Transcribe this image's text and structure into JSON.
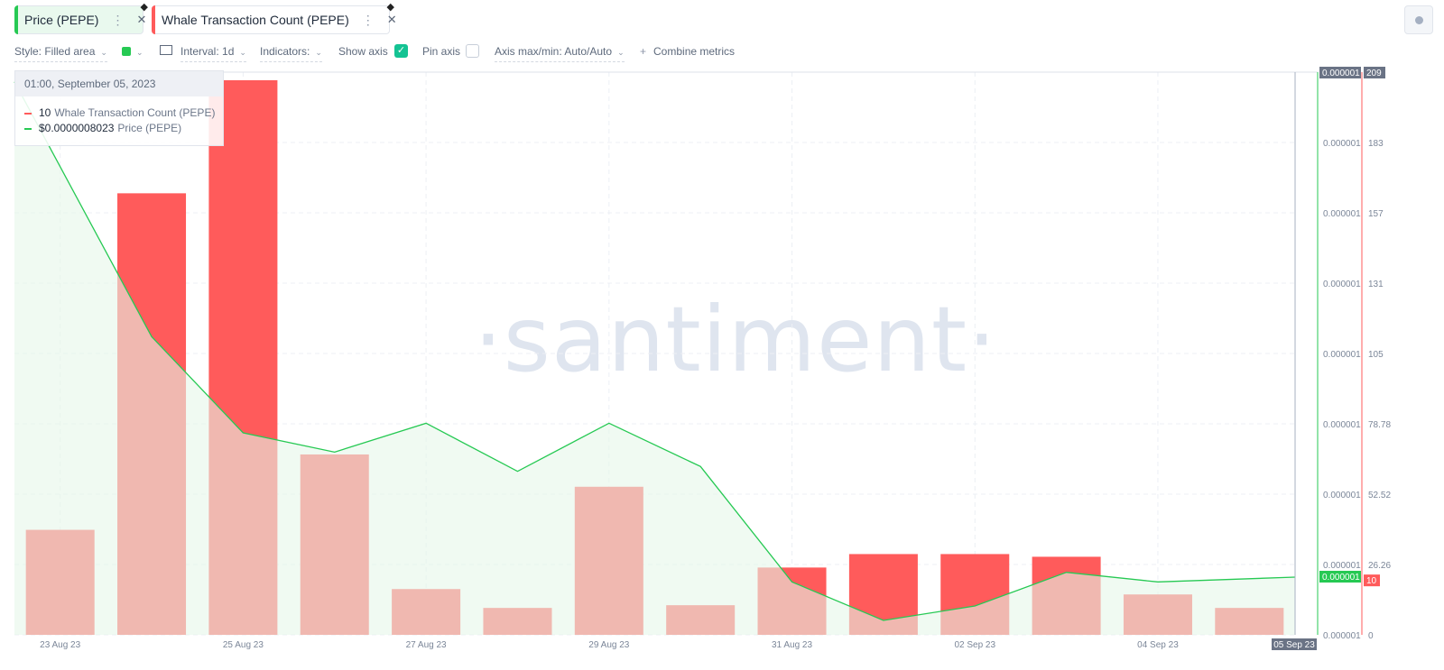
{
  "tabs": [
    {
      "label": "Price (PEPE)",
      "color": "#26c953"
    },
    {
      "label": "Whale Transaction Count (PEPE)",
      "color": "#ff5b5b"
    }
  ],
  "toolbar": {
    "style": "Style: Filled area",
    "interval": "Interval: 1d",
    "indicators": "Indicators:",
    "show_axis": "Show axis",
    "pin_axis": "Pin axis",
    "axis_maxmin": "Axis max/min: Auto/Auto",
    "combine": "Combine metrics",
    "show_axis_checked": true,
    "pin_axis_checked": false
  },
  "watermark": "·santiment·",
  "tooltip": {
    "date": "01:00, September 05, 2023",
    "rows": [
      {
        "value": "10",
        "name": "Whale Transaction Count (PEPE)",
        "color": "#ff5b5b"
      },
      {
        "value": "$0.0000008023",
        "name": "Price (PEPE)",
        "color": "#26c953"
      }
    ]
  },
  "chart_data": {
    "type": "bar",
    "x": [
      "23 Aug 23",
      "24 Aug 23",
      "25 Aug 23",
      "26 Aug 23",
      "27 Aug 23",
      "28 Aug 23",
      "29 Aug 23",
      "30 Aug 23",
      "31 Aug 23",
      "01 Sep 23",
      "02 Sep 23",
      "03 Sep 23",
      "04 Sep 23",
      "05 Sep 23"
    ],
    "x_tick_labels": [
      "23 Aug 23",
      "25 Aug 23",
      "27 Aug 23",
      "29 Aug 23",
      "31 Aug 23",
      "02 Sep 23",
      "04 Sep 23"
    ],
    "x_last_label": "05 Sep 23",
    "series": [
      {
        "name": "Whale Transaction Count (PEPE)",
        "type": "bar",
        "color": "#ff5b5b",
        "values": [
          39,
          164,
          206,
          67,
          17,
          10,
          55,
          11,
          25,
          30,
          30,
          29,
          15,
          10
        ],
        "axis_ticks": [
          "0",
          "26.26",
          "52.52",
          "78.78",
          "105",
          "131",
          "157",
          "183",
          "209"
        ],
        "axis_min": 0,
        "axis_max": 209,
        "current_value_label": "10",
        "max_label": "209"
      },
      {
        "name": "Price (PEPE)",
        "type": "area",
        "color": "#26c953",
        "fill": "#e6f7e9",
        "values": [
          9.6e-07,
          9.07e-07,
          8.87e-07,
          8.83e-07,
          8.89e-07,
          8.79e-07,
          8.89e-07,
          8.8e-07,
          8.56e-07,
          8.48e-07,
          8.51e-07,
          8.58e-07,
          8.56e-07,
          8.57e-07
        ],
        "axis_ticks": [
          "0.000001",
          "0.000001",
          "0.000001",
          "0.000001",
          "0.000001",
          "0.000001",
          "0.000001",
          "0.000001",
          "0.000001"
        ],
        "axis_min": 8.45e-07,
        "axis_max": 9.62e-07,
        "current_value_label": "0.000001",
        "max_label": "0.000001"
      }
    ],
    "grid": true,
    "legend": "top-left tooltip"
  }
}
